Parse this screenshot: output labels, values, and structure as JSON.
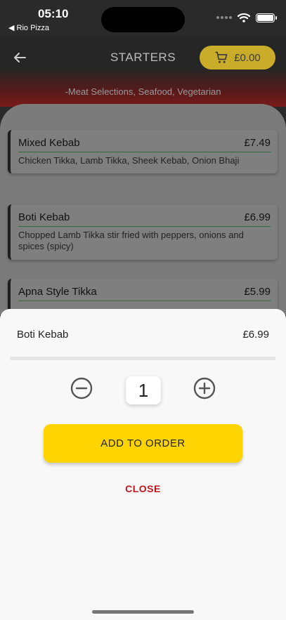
{
  "status_bar": {
    "time": "05:10",
    "back_app": "◀ Rio Pizza"
  },
  "header": {
    "title": "STARTERS",
    "cart_total": "£0.00",
    "subtitle": "-Meat Selections, Seafood, Vegetarian"
  },
  "menu_items": [
    {
      "name": "Mixed Kebab",
      "price": "£7.49",
      "description": "Chicken Tikka, Lamb Tikka, Sheek Kebab, Onion Bhaji"
    },
    {
      "name": "Boti Kebab",
      "price": "£6.99",
      "description": "Chopped Lamb Tikka stir fried with peppers, onions and spices (spicy)"
    },
    {
      "name": "Apna Style Tikka",
      "price": "£5.99",
      "description": ""
    }
  ],
  "sheet": {
    "item_name": "Boti Kebab",
    "item_price": "£6.99",
    "quantity": "1",
    "add_label": "ADD TO ORDER",
    "close_label": "CLOSE"
  },
  "colors": {
    "accent": "#ffd400",
    "close": "#c0141b",
    "header_gradient_end": "#7a1a1a"
  },
  "icons": {
    "back": "back-arrow-icon",
    "cart": "cart-icon",
    "minus": "minus-circle-icon",
    "plus": "plus-circle-icon"
  }
}
